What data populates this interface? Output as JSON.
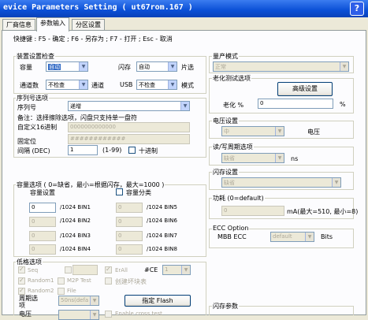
{
  "window": {
    "title": "evice Parameters Setting ( ut67rom.167 )"
  },
  "tabs": [
    "厂商信息",
    "参数输入",
    "分区设置"
  ],
  "shortcut": "快捷键 : F5 - 确定 ; F6 - 另存为 ; F7 - 打开 ; Esc - 取消",
  "scan": {
    "title": "装置设置检查",
    "capacity_label": "容量",
    "capacity_value": "自动",
    "flash_label": "闪存",
    "flash_value": "自动",
    "chip_label": "片选",
    "channel_label": "通道数",
    "channel_value": "不检查",
    "channel_suffix": "通道",
    "usb_label": "USB",
    "usb_value": "不检查",
    "mode_label": "模式"
  },
  "serial": {
    "title": "序列号选项",
    "sn_label": "序列号",
    "sn_value": "递增",
    "note": "备注：选择擦除选项，闪盘只支持单一盘符",
    "custom_label": "自定义16进制",
    "custom_value": "0000000000000",
    "fixed_label": "固定位",
    "fixed_value": "############",
    "interval_label": "间隔 (DEC)",
    "interval_value": "1",
    "interval_range": "(1-99)",
    "decimal_label": "十进制"
  },
  "capacity_opts": {
    "title": "容量选项 ( 0=缺省，最小=根据闪存，最大=1000 )",
    "set_label": "容量设置",
    "split_label": "容量分类",
    "bins": [
      {
        "value": "0",
        "label": "/1024 BIN1"
      },
      {
        "value": "0",
        "label": "/1024 BIN2"
      },
      {
        "value": "0",
        "label": "/1024 BIN3"
      },
      {
        "value": "0",
        "label": "/1024 BIN4"
      },
      {
        "value": "0",
        "label": "/1024 BIN5"
      },
      {
        "value": "0",
        "label": "/1024 BIN6"
      },
      {
        "value": "0",
        "label": "/1024 BIN7"
      },
      {
        "value": "0",
        "label": "/1024 BIN8"
      }
    ]
  },
  "lowfmt": {
    "title": "低格选项",
    "seq": "Seq",
    "random1": "Random1",
    "random2": "Random2",
    "erall": "ErAll",
    "m2p": "M2P Test",
    "file": "File",
    "ce_label": "#CE",
    "ce_value": "1",
    "bad_block": "创建坏块表",
    "period_label": "周期选项",
    "period_value": "50ns(defa",
    "flash_btn": "指定 Flash",
    "voltage_label": "电压",
    "enable_cross": "Enable cross test"
  },
  "mass_mode": {
    "title": "量产模式",
    "value": "正常"
  },
  "aging": {
    "title": "老化测试选项",
    "adv_btn": "高级设置",
    "aging_label": "老化 %",
    "aging_value": "0",
    "pct": "%"
  },
  "voltage": {
    "title": "电压设置",
    "value": "中",
    "label": "电压"
  },
  "rw_cycle": {
    "title": "读/写周期选项",
    "value": "缺省",
    "unit": "ns"
  },
  "flash_set": {
    "title": "闪存设置",
    "value": "缺省"
  },
  "power": {
    "title": "功耗 (0=default)",
    "value": "0",
    "hint": "mA(最大=510, 最小=8)"
  },
  "ecc": {
    "title": "ECC Option",
    "mbb_label": "MBB ECC",
    "value": "default",
    "bits": "Bits"
  },
  "flash_params": {
    "title": "闪存参数"
  }
}
